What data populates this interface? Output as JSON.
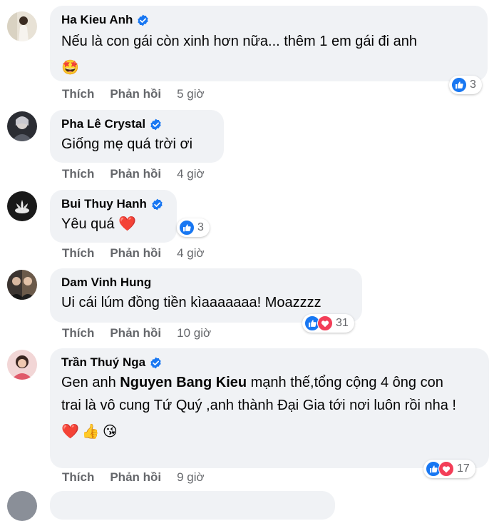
{
  "labels": {
    "like": "Thích",
    "reply": "Phản hồi"
  },
  "comments": [
    {
      "name": "Ha Kieu Anh",
      "text": "Nếu là con gái còn xinh hơn nữa... thêm 1 em gái đi anh",
      "emoji": "🤩",
      "time": "5 giờ",
      "reaction_count": "3",
      "reaction_icons": [
        "like-icon"
      ]
    },
    {
      "name": "Pha Lê Crystal",
      "text": "Giống mẹ quá trời ơi",
      "time": "4 giờ"
    },
    {
      "name": "Bui Thuy Hanh",
      "text": "Yêu quá",
      "text_emoji": "❤️",
      "time": "4 giờ",
      "reaction_count": "3",
      "reaction_icons": [
        "like-icon"
      ]
    },
    {
      "name": "Dam Vinh Hung",
      "text": "Ui cái lúm đồng tiền kìaaaaaaa! Moazzzz",
      "time": "10 giờ",
      "reaction_count": "31",
      "reaction_icons": [
        "like-icon",
        "love-icon"
      ]
    },
    {
      "name": "Trần Thuý Nga",
      "text_prefix": "Gen anh ",
      "tag": "Nguyen Bang Kieu",
      "text_suffix": " mạnh thế,tổng cộng 4 ông con trai là vô cung Tứ Quý ,anh thành Đại Gia tới nơi luôn rồi nha !",
      "emojis": [
        "❤️",
        "👍",
        "😘"
      ],
      "time": "9 giờ",
      "reaction_count": "17",
      "reaction_icons": [
        "like-icon",
        "love-icon"
      ]
    }
  ],
  "colors": {
    "bubble": "#f0f2f5",
    "meta_text": "#65676b",
    "verified": "#1877f2",
    "like": "#1877f2",
    "love": "#f33e58"
  }
}
